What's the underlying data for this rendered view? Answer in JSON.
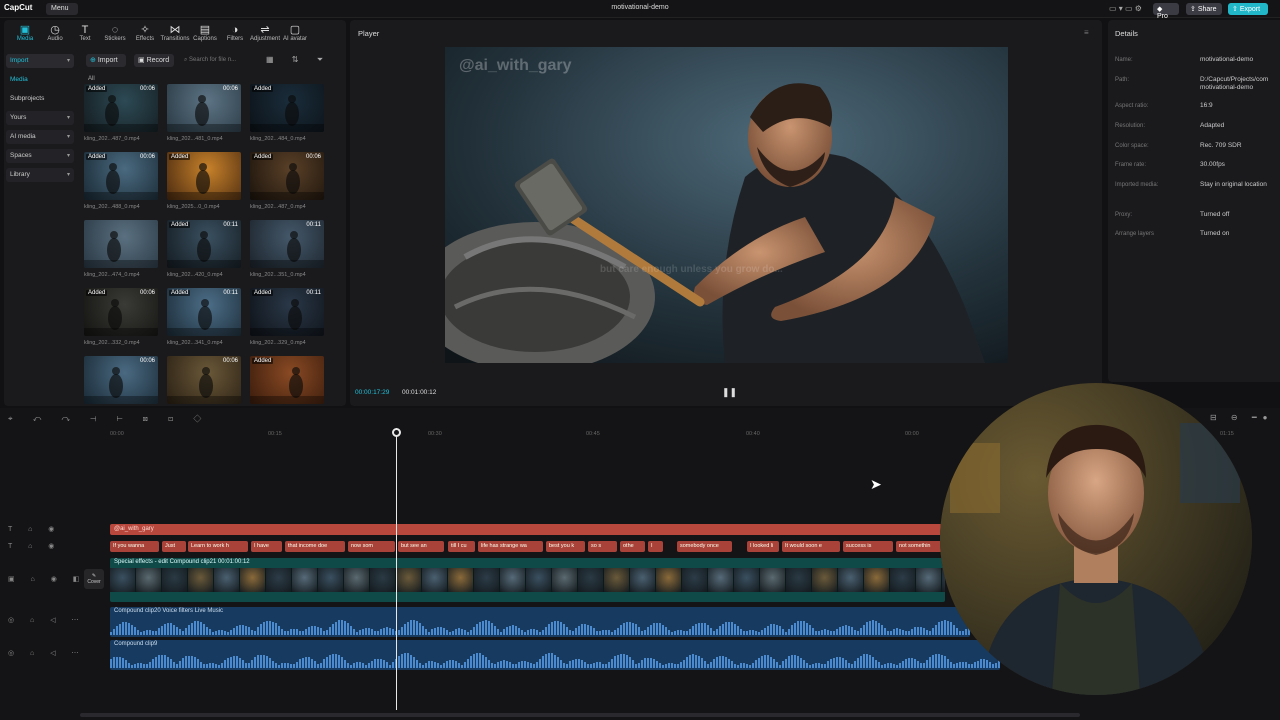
{
  "app": {
    "logo": "CapCut",
    "menu_label": "Menu",
    "title": "motivational-demo"
  },
  "top_actions": {
    "pro": "Pro",
    "share": "Share",
    "export": "Export"
  },
  "toolbar": [
    {
      "label": "Media",
      "icon": "media-icon",
      "glyph": "▣",
      "active": true
    },
    {
      "label": "Audio",
      "icon": "audio-icon",
      "glyph": "◷"
    },
    {
      "label": "Text",
      "icon": "text-icon",
      "glyph": "T"
    },
    {
      "label": "Stickers",
      "icon": "sticker-icon",
      "glyph": "◌"
    },
    {
      "label": "Effects",
      "icon": "effects-icon",
      "glyph": "✧"
    },
    {
      "label": "Transitions",
      "icon": "transitions-icon",
      "glyph": "⋈"
    },
    {
      "label": "Captions",
      "icon": "captions-icon",
      "glyph": "▤"
    },
    {
      "label": "Filters",
      "icon": "filters-icon",
      "glyph": "◑"
    },
    {
      "label": "Adjustment",
      "icon": "adjustment-icon",
      "glyph": "⇌"
    },
    {
      "label": "AI avatar",
      "icon": "ai-avatar-icon",
      "glyph": "▢"
    }
  ],
  "side_nav": [
    {
      "label": "Import",
      "type": "dropdown-active"
    },
    {
      "label": "Media",
      "type": "selected"
    },
    {
      "label": "Subprojects",
      "type": "plain"
    },
    {
      "label": "Yours",
      "type": "dropdown"
    },
    {
      "label": "AI media",
      "type": "dropdown"
    },
    {
      "label": "Spaces",
      "type": "dropdown"
    },
    {
      "label": "Library",
      "type": "dropdown"
    }
  ],
  "media": {
    "import_label": "Import",
    "record_label": "Record",
    "search_placeholder": "Search for file n...",
    "all_label": "All",
    "items": [
      {
        "name": "kling_202...487_0.mp4",
        "badge": "Added",
        "dur": "00:06",
        "c1": "#2d4a55",
        "c2": "#141c20"
      },
      {
        "name": "kling_202...481_0.mp4",
        "badge": "",
        "dur": "00:06",
        "c1": "#5d7485",
        "c2": "#2a3a44"
      },
      {
        "name": "kling_202...484_0.mp4",
        "badge": "Added",
        "dur": "",
        "c1": "#1a2d3b",
        "c2": "#0c1218"
      },
      {
        "name": "kling_202...488_0.mp4",
        "badge": "Added",
        "dur": "00:06",
        "c1": "#4a6a80",
        "c2": "#1a2a35"
      },
      {
        "name": "kling_2025...0_0.mp4",
        "badge": "Added",
        "dur": "",
        "c1": "#c8822a",
        "c2": "#4a2a10"
      },
      {
        "name": "kling_202...487_0.mp4",
        "badge": "Added",
        "dur": "00:06",
        "c1": "#5a4028",
        "c2": "#1c140c"
      },
      {
        "name": "kling_202...474_0.mp4",
        "badge": "",
        "dur": "",
        "c1": "#5a7080",
        "c2": "#2a3844"
      },
      {
        "name": "kling_202...420_0.mp4",
        "badge": "Added",
        "dur": "00:11",
        "c1": "#3a5060",
        "c2": "#141c22"
      },
      {
        "name": "kling_202...351_0.mp4",
        "badge": "",
        "dur": "00:11",
        "c1": "#44586a",
        "c2": "#1c242c"
      },
      {
        "name": "kling_202...332_0.mp4",
        "badge": "Added",
        "dur": "00:06",
        "c1": "#3a3a36",
        "c2": "#141412"
      },
      {
        "name": "kling_202...341_0.mp4",
        "badge": "Added",
        "dur": "00:11",
        "c1": "#4c6e88",
        "c2": "#1c2c38"
      },
      {
        "name": "kling_202...329_0.mp4",
        "badge": "Added",
        "dur": "00:11",
        "c1": "#2a3848",
        "c2": "#0e1218"
      },
      {
        "name": "",
        "badge": "",
        "dur": "00:06",
        "c1": "#4a6a82",
        "c2": "#1a2a36"
      },
      {
        "name": "",
        "badge": "",
        "dur": "00:06",
        "c1": "#6a5838",
        "c2": "#2a2014"
      },
      {
        "name": "",
        "badge": "Added",
        "dur": "",
        "c1": "#8a4a24",
        "c2": "#3a1c0c"
      }
    ]
  },
  "player": {
    "title": "Player",
    "watermark": "@ai_with_gary",
    "subtitle": "but care enough unless you grow do...",
    "time_current": "00:00:17:29",
    "time_total": "00:01:00:12"
  },
  "details": {
    "title": "Details",
    "rows": [
      {
        "key": "Name:",
        "value": "motivational-demo"
      },
      {
        "key": "Path:",
        "value": "D:/Capcut/Projects/com motivational-demo"
      },
      {
        "key": "Aspect ratio:",
        "value": "16:9"
      },
      {
        "key": "Resolution:",
        "value": "Adapted"
      },
      {
        "key": "Color space:",
        "value": "Rec. 709 SDR"
      },
      {
        "key": "Frame rate:",
        "value": "30.00fps"
      },
      {
        "key": "Imported media:",
        "value": "Stay in original location"
      },
      {
        "key": "Proxy:",
        "value": "Turned off"
      },
      {
        "key": "Arrange layers",
        "value": "Turned on"
      }
    ]
  },
  "timeline": {
    "ruler": [
      "00:00",
      "00:15",
      "00:30",
      "00:45",
      "00:40",
      "00:00",
      "01:15"
    ],
    "text_track1": "@ai_with_gary",
    "captions": [
      "If you wanna",
      "Just",
      "Learn to work h",
      "I have",
      "that income doe",
      "now som",
      "but see an",
      "till I cu",
      "life has strange wa",
      "best you k",
      "so s",
      "othe",
      "I",
      "somebody once",
      "I looked li",
      "It would soon e",
      "success is",
      "not somethin"
    ],
    "video_label": "Special effects - edit   Compound clip21  00:01:00:12",
    "cover_label": "Cover",
    "audio1_label": "Compound clip20  Voice filters Live Music",
    "audio2_label": "Compound clip9"
  },
  "colors": {
    "accent": "#22c0d8",
    "export": "#22b7c8",
    "text_track": "#b8483d",
    "video_track": "#0f4a48",
    "audio_track": "#173a60"
  }
}
